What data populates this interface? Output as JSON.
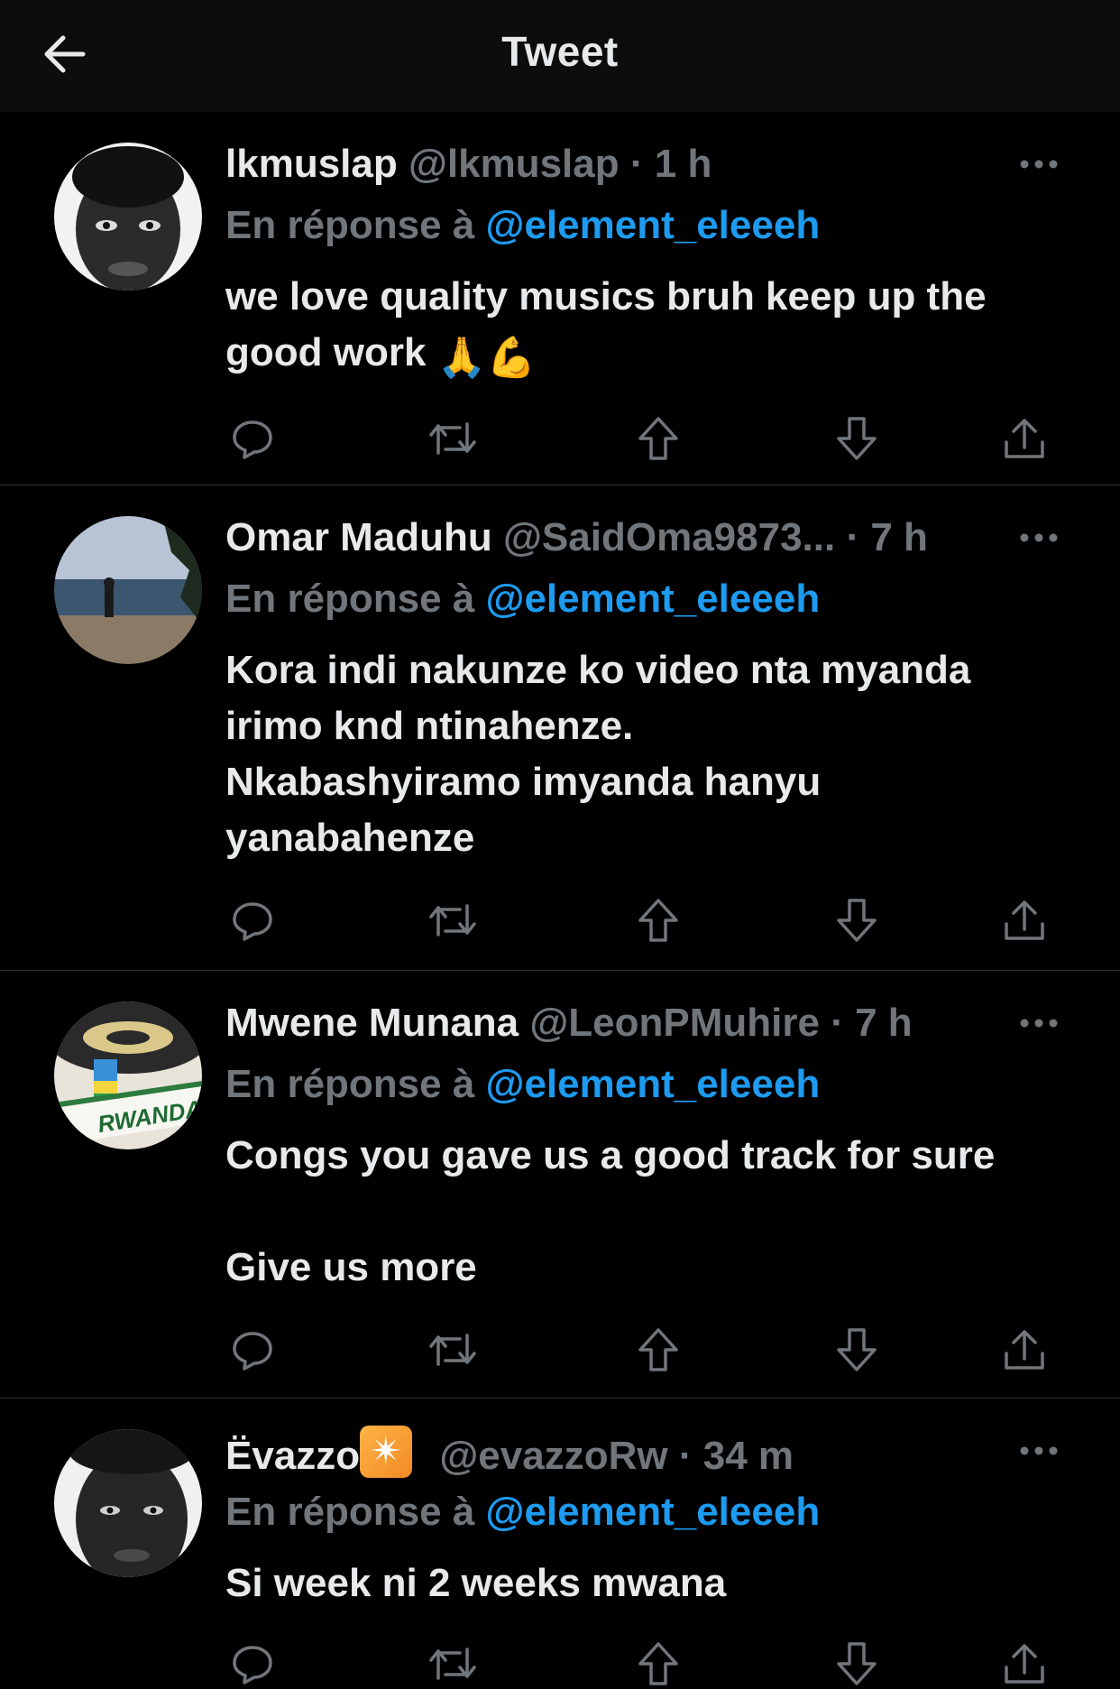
{
  "header": {
    "title": "Tweet",
    "back_icon": "arrow-left-icon"
  },
  "tweets": [
    {
      "name": "lkmuslap",
      "handle": "@lkmuslap",
      "time": "1 h",
      "reply_prefix": "En réponse à",
      "reply_to": "@element_eleeeh",
      "text": "we love quality musics bruh keep up the good work",
      "emojis": [
        "🙏",
        "💪"
      ]
    },
    {
      "name": "Omar Maduhu",
      "handle": "@SaidOma9873...",
      "time": "7 h",
      "reply_prefix": "En réponse à",
      "reply_to": "@element_eleeeh",
      "text": "Kora indi nakunze ko video nta myanda irimo knd ntinahenze.\nNkabashyiramo imyanda hanyu yanabahenze"
    },
    {
      "name": "Mwene Munana",
      "handle": "@LeonPMuhire",
      "time": "7 h",
      "reply_prefix": "En réponse à",
      "reply_to": "@element_eleeeh",
      "text": "Congs you gave us a good track for sure\n\nGive us more",
      "avatar_text": "RWANDA"
    },
    {
      "name": "Ëvazzo",
      "badge": "✴",
      "handle": "@evazzoRw",
      "time": "34 m",
      "reply_prefix": "En réponse à",
      "reply_to": "@element_eleeeh",
      "text": "Si week ni 2 weeks mwana"
    }
  ],
  "separator": "·",
  "action_icons": [
    "reply-icon",
    "retweet-icon",
    "upvote-icon",
    "downvote-icon",
    "share-icon"
  ],
  "more_icon": "more-horizontal-icon",
  "colors": {
    "background": "#000000",
    "header_background": "#0d0d0d",
    "text": "#e7e9ea",
    "muted": "#71767b",
    "link": "#1d9bf0",
    "divider": "#2f3336"
  }
}
